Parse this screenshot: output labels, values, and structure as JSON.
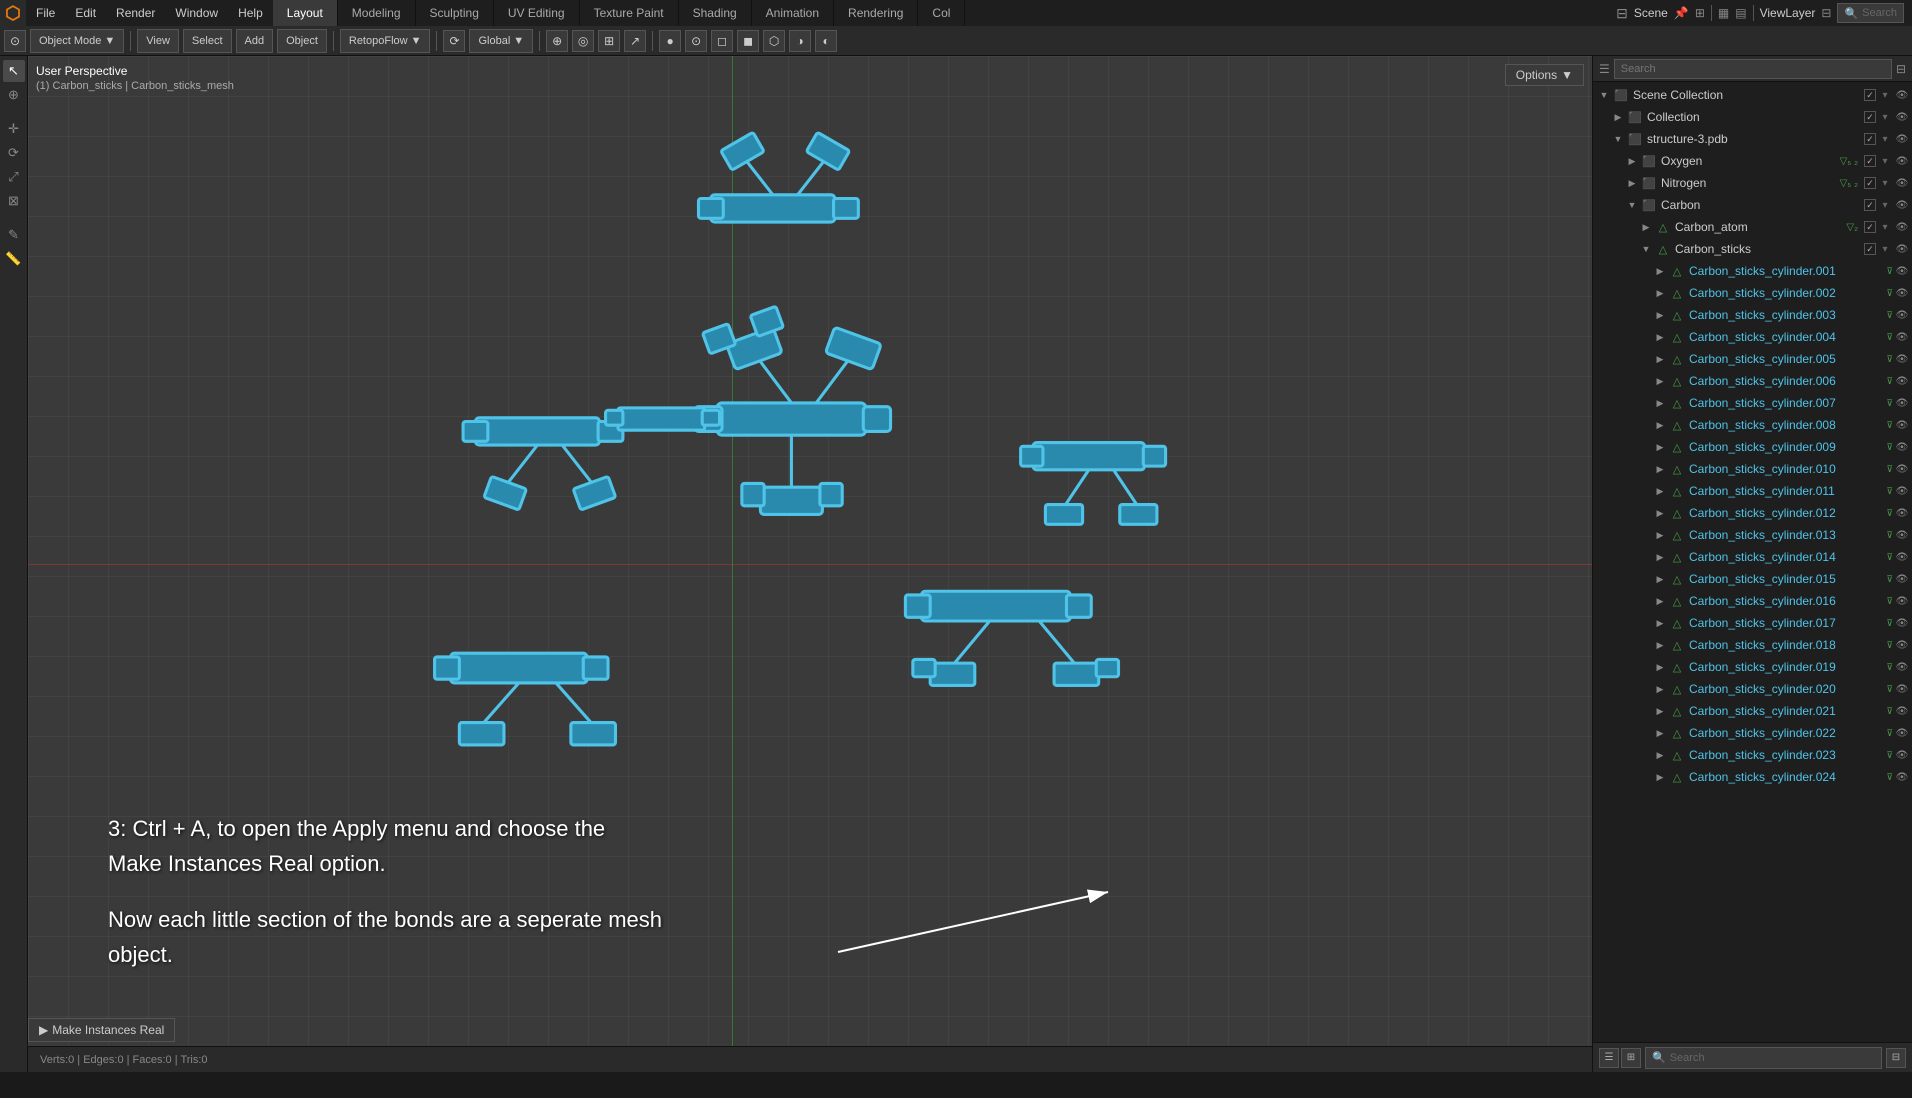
{
  "app": {
    "title": "Blender",
    "logo": "⬡"
  },
  "top_menu": {
    "items": [
      "File",
      "Edit",
      "Render",
      "Window",
      "Help"
    ]
  },
  "workspace_tabs": [
    {
      "label": "Layout",
      "active": true
    },
    {
      "label": "Modeling",
      "active": false
    },
    {
      "label": "Sculpting",
      "active": false
    },
    {
      "label": "UV Editing",
      "active": false
    },
    {
      "label": "Texture Paint",
      "active": false
    },
    {
      "label": "Shading",
      "active": false
    },
    {
      "label": "Animation",
      "active": false
    },
    {
      "label": "Rendering",
      "active": false
    },
    {
      "label": "Col",
      "active": false
    }
  ],
  "header_right": {
    "scene_label": "Scene",
    "view_layer_label": "ViewLayer",
    "search_placeholder": "Search"
  },
  "toolbar2": {
    "mode_label": "Object Mode",
    "view_label": "View",
    "select_label": "Select",
    "add_label": "Add",
    "object_label": "Object",
    "addon_label": "RetopoFlow",
    "transform_label": "Global",
    "options_label": "Options"
  },
  "viewport": {
    "perspective_label": "User Perspective",
    "breadcrumb": "(1) Carbon_sticks | Carbon_sticks_mesh",
    "annotation_line1": "3: Ctrl + A,  to open the Apply menu and choose the",
    "annotation_line2": "Make Instances Real option.",
    "annotation_line3": "Now each little section of the bonds are a seperate mesh object.",
    "options_btn": "Options"
  },
  "outliner": {
    "search_placeholder": "Search",
    "scene_collection": "Scene Collection",
    "items": [
      {
        "id": "scene-collection",
        "label": "Scene Collection",
        "depth": 0,
        "expanded": true,
        "icon": "collection",
        "has_expander": true
      },
      {
        "id": "collection",
        "label": "Collection",
        "depth": 1,
        "expanded": false,
        "icon": "collection",
        "has_expander": true
      },
      {
        "id": "structure-3pdb",
        "label": "structure-3.pdb",
        "depth": 1,
        "expanded": true,
        "icon": "collection",
        "has_expander": true
      },
      {
        "id": "oxygen",
        "label": "Oxygen",
        "depth": 2,
        "expanded": false,
        "icon": "collection",
        "has_expander": true,
        "suffix": "▽₅₂"
      },
      {
        "id": "nitrogen",
        "label": "Nitrogen",
        "depth": 2,
        "expanded": false,
        "icon": "collection",
        "has_expander": true,
        "suffix": "▽₅₂"
      },
      {
        "id": "carbon",
        "label": "Carbon",
        "depth": 2,
        "expanded": true,
        "icon": "collection",
        "has_expander": true
      },
      {
        "id": "carbon-atom",
        "label": "Carbon_atom",
        "depth": 3,
        "expanded": false,
        "icon": "mesh",
        "has_expander": true,
        "suffix": "▽₂"
      },
      {
        "id": "carbon-sticks",
        "label": "Carbon_sticks",
        "depth": 3,
        "expanded": true,
        "icon": "mesh",
        "has_expander": true
      },
      {
        "id": "cyl001",
        "label": "Carbon_sticks_cylinder.001",
        "depth": 4,
        "expanded": false,
        "icon": "mesh",
        "has_expander": true,
        "cyan": true
      },
      {
        "id": "cyl002",
        "label": "Carbon_sticks_cylinder.002",
        "depth": 4,
        "expanded": false,
        "icon": "mesh",
        "has_expander": true,
        "cyan": true
      },
      {
        "id": "cyl003",
        "label": "Carbon_sticks_cylinder.003",
        "depth": 4,
        "expanded": false,
        "icon": "mesh",
        "has_expander": true,
        "cyan": true
      },
      {
        "id": "cyl004",
        "label": "Carbon_sticks_cylinder.004",
        "depth": 4,
        "expanded": false,
        "icon": "mesh",
        "has_expander": true,
        "cyan": true
      },
      {
        "id": "cyl005",
        "label": "Carbon_sticks_cylinder.005",
        "depth": 4,
        "expanded": false,
        "icon": "mesh",
        "has_expander": true,
        "cyan": true
      },
      {
        "id": "cyl006",
        "label": "Carbon_sticks_cylinder.006",
        "depth": 4,
        "expanded": false,
        "icon": "mesh",
        "has_expander": true,
        "cyan": true
      },
      {
        "id": "cyl007",
        "label": "Carbon_sticks_cylinder.007",
        "depth": 4,
        "expanded": false,
        "icon": "mesh",
        "has_expander": true,
        "cyan": true
      },
      {
        "id": "cyl008",
        "label": "Carbon_sticks_cylinder.008",
        "depth": 4,
        "expanded": false,
        "icon": "mesh",
        "has_expander": true,
        "cyan": true
      },
      {
        "id": "cyl009",
        "label": "Carbon_sticks_cylinder.009",
        "depth": 4,
        "expanded": false,
        "icon": "mesh",
        "has_expander": true,
        "cyan": true
      },
      {
        "id": "cyl010",
        "label": "Carbon_sticks_cylinder.010",
        "depth": 4,
        "expanded": false,
        "icon": "mesh",
        "has_expander": true,
        "cyan": true
      },
      {
        "id": "cyl011",
        "label": "Carbon_sticks_cylinder.011",
        "depth": 4,
        "expanded": false,
        "icon": "mesh",
        "has_expander": true,
        "cyan": true
      },
      {
        "id": "cyl012",
        "label": "Carbon_sticks_cylinder.012",
        "depth": 4,
        "expanded": false,
        "icon": "mesh",
        "has_expander": true,
        "cyan": true
      },
      {
        "id": "cyl013",
        "label": "Carbon_sticks_cylinder.013",
        "depth": 4,
        "expanded": false,
        "icon": "mesh",
        "has_expander": true,
        "cyan": true
      },
      {
        "id": "cyl014",
        "label": "Carbon_sticks_cylinder.014",
        "depth": 4,
        "expanded": false,
        "icon": "mesh",
        "has_expander": true,
        "cyan": true
      },
      {
        "id": "cyl015",
        "label": "Carbon_sticks_cylinder.015",
        "depth": 4,
        "expanded": false,
        "icon": "mesh",
        "has_expander": true,
        "cyan": true
      },
      {
        "id": "cyl016",
        "label": "Carbon_sticks_cylinder.016",
        "depth": 4,
        "expanded": false,
        "icon": "mesh",
        "has_expander": true,
        "cyan": true
      },
      {
        "id": "cyl017",
        "label": "Carbon_sticks_cylinder.017",
        "depth": 4,
        "expanded": false,
        "icon": "mesh",
        "has_expander": true,
        "cyan": true
      },
      {
        "id": "cyl018",
        "label": "Carbon_sticks_cylinder.018",
        "depth": 4,
        "expanded": false,
        "icon": "mesh",
        "has_expander": true,
        "cyan": true
      },
      {
        "id": "cyl019",
        "label": "Carbon_sticks_cylinder.019",
        "depth": 4,
        "expanded": false,
        "icon": "mesh",
        "has_expander": true,
        "cyan": true
      },
      {
        "id": "cyl020",
        "label": "Carbon_sticks_cylinder.020",
        "depth": 4,
        "expanded": false,
        "icon": "mesh",
        "has_expander": true,
        "cyan": true
      },
      {
        "id": "cyl021",
        "label": "Carbon_sticks_cylinder.021",
        "depth": 4,
        "expanded": false,
        "icon": "mesh",
        "has_expander": true,
        "cyan": true
      },
      {
        "id": "cyl022",
        "label": "Carbon_sticks_cylinder.022",
        "depth": 4,
        "expanded": false,
        "icon": "mesh",
        "has_expander": true,
        "cyan": true
      },
      {
        "id": "cyl023",
        "label": "Carbon_sticks_cylinder.023",
        "depth": 4,
        "expanded": false,
        "icon": "mesh",
        "has_expander": true,
        "cyan": true
      },
      {
        "id": "cyl024",
        "label": "Carbon_sticks_cylinder.024",
        "depth": 4,
        "expanded": false,
        "icon": "mesh",
        "has_expander": true,
        "cyan": true
      }
    ]
  },
  "bottom_bar": {
    "make_instances_real": "Make Instances Real",
    "search_placeholder": "Search"
  },
  "icons": {
    "expand_right": "▶",
    "expand_down": "▼",
    "collection": "■",
    "mesh": "△",
    "eye": "👁",
    "funnel": "⊽",
    "check": "✓",
    "camera": "⊡"
  }
}
